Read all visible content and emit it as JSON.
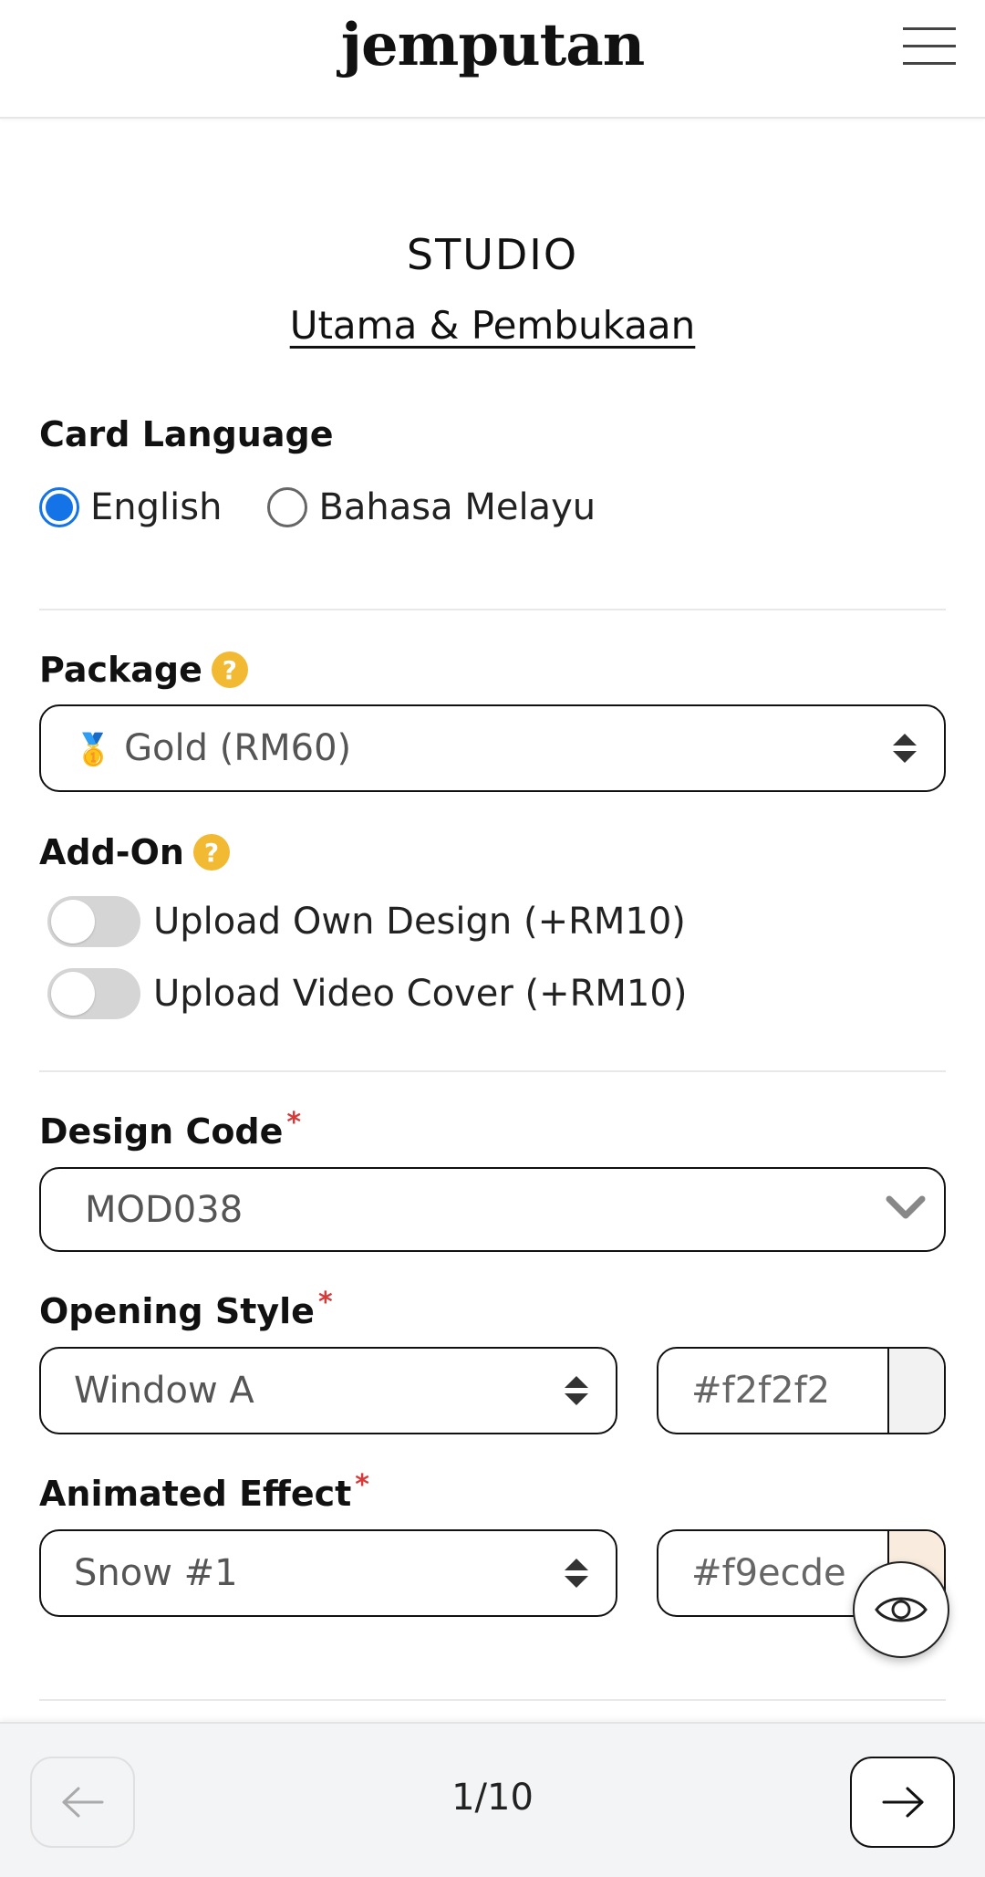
{
  "header": {
    "logo": "jemputan",
    "menu_icon": "hamburger-menu-icon"
  },
  "studio": {
    "title": "STUDIO",
    "subtitle": "Utama & Pembukaan"
  },
  "card_language": {
    "label": "Card Language",
    "options": [
      {
        "label": "English",
        "selected": true
      },
      {
        "label": "Bahasa Melayu",
        "selected": false
      }
    ]
  },
  "package": {
    "label": "Package",
    "help": "?",
    "medal": "🥇",
    "value": "Gold (RM60)"
  },
  "addon": {
    "label": "Add-On",
    "help": "?",
    "items": [
      {
        "label": "Upload Own Design (+RM10)",
        "on": false
      },
      {
        "label": "Upload Video Cover (+RM10)",
        "on": false
      }
    ]
  },
  "design_code": {
    "label": "Design Code",
    "required": "*",
    "value": "MOD038"
  },
  "opening_style": {
    "label": "Opening Style",
    "required": "*",
    "value": "Window A",
    "color": "#f2f2f2"
  },
  "animated_effect": {
    "label": "Animated Effect",
    "required": "*",
    "value": "Snow #1",
    "color": "#f9ecde"
  },
  "footer": {
    "page_indicator": "1/10"
  }
}
